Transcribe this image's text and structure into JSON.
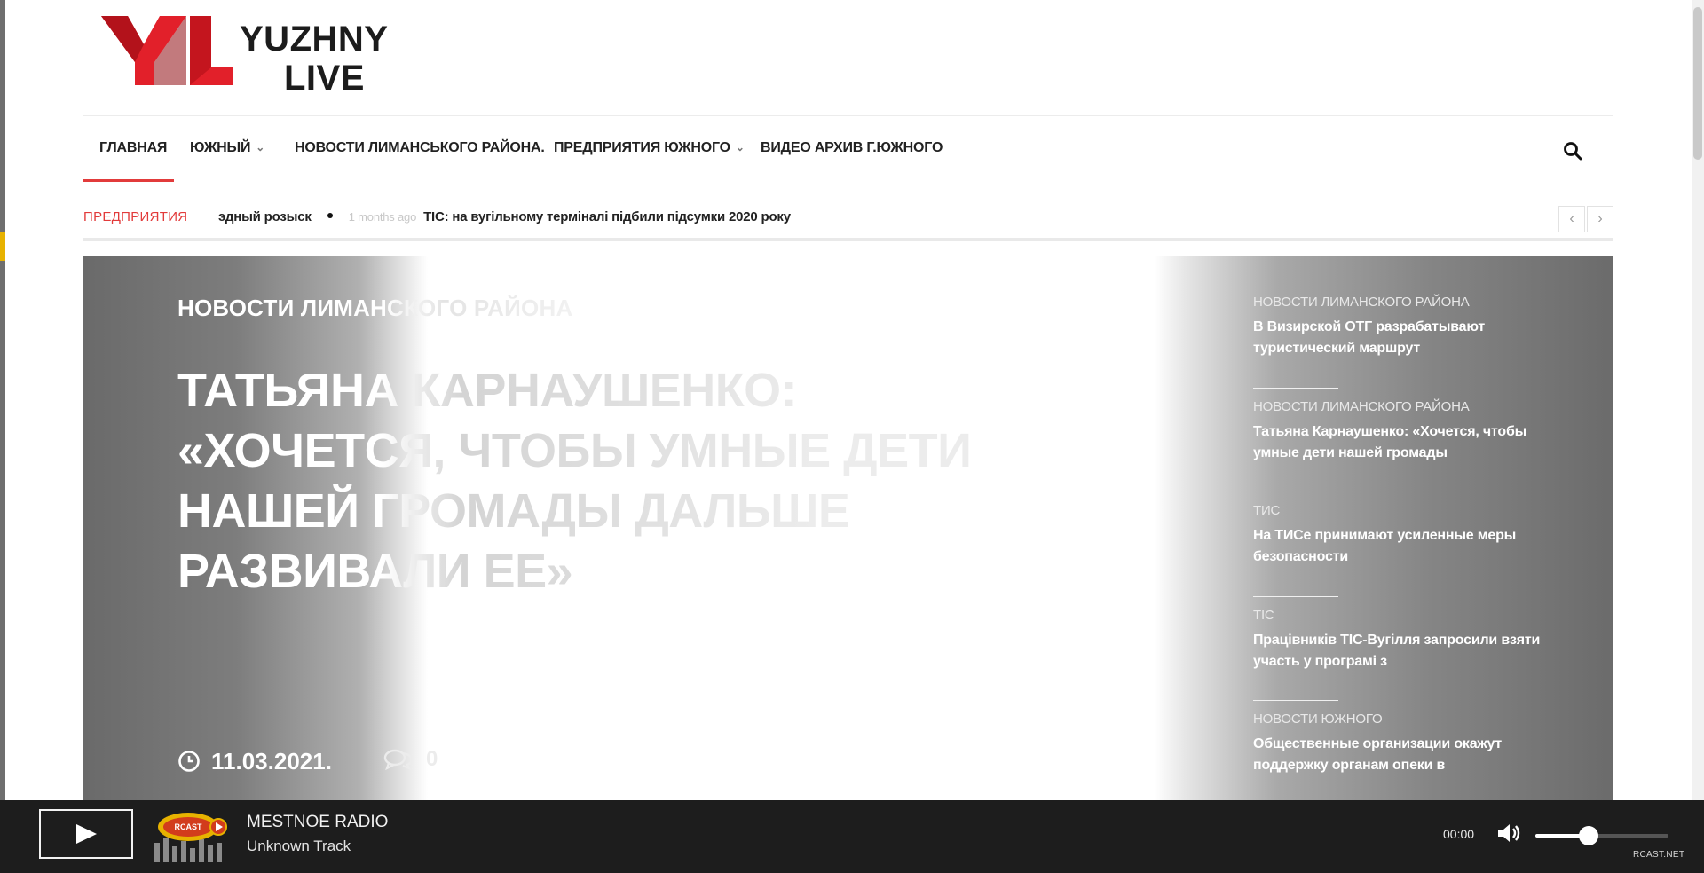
{
  "site": {
    "logo_line1": "YUZHNY",
    "logo_line2": "LIVE",
    "brand_color": "#e2202a"
  },
  "nav": {
    "items": [
      {
        "label": "ГЛАВНАЯ",
        "dropdown": false,
        "active": true
      },
      {
        "label": "ЮЖНЫЙ",
        "dropdown": true,
        "active": false
      },
      {
        "label": "НОВОСТИ ЛИМАНСЬКОГО РАЙОНА.",
        "dropdown": false,
        "active": false
      },
      {
        "label": "ПРЕДПРИЯТИЯ ЮЖНОГО",
        "dropdown": true,
        "active": false
      },
      {
        "label": "ВИДЕО АРХИВ Г.ЮЖНОГО",
        "dropdown": false,
        "active": false
      }
    ],
    "chevron": "⌄",
    "accent_color": "#e23b3b"
  },
  "ticker": {
    "label": "ПРЕДПРИЯТИЯ",
    "prev_text": "эдный розыск",
    "time_ago": "1 months ago",
    "headline": "ТІС: на вугільному терміналі підбили підсумки 2020 року",
    "prev_arrow": "‹",
    "next_arrow": "›"
  },
  "hero": {
    "category": "НОВОСТИ ЛИМАНСКОГО РАЙОНА",
    "title": "ТАТЬЯНА КАРНАУШЕНКО: «ХОЧЕТСЯ, ЧТОБЫ УМНЫЕ ДЕТИ НАШЕЙ ГРОМАДЫ ДАЛЬШЕ РАЗВИВАЛИ ЕЕ»",
    "date": "11.03.2021.",
    "comments": "0",
    "side": [
      {
        "category": "НОВОСТИ ЛИМАНСКОГО РАЙОНА",
        "title": "В Визирской ОТГ разрабатывают туристический маршрут"
      },
      {
        "category": "НОВОСТИ ЛИМАНСКОГО РАЙОНА",
        "title": "Татьяна Карнаушенко: «Хочется, чтобы умные дети нашей громады"
      },
      {
        "category": "ТИС",
        "title": "На ТИСе принимают усиленные меры безопасности"
      },
      {
        "category": "ТІС",
        "title": "Працівників ТІС-Вугілля запросили взяти участь у програмі з"
      },
      {
        "category": "НОВОСТИ ЮЖНОГО",
        "title": "Общественные организации окажут поддержку органам опеки в"
      }
    ]
  },
  "player": {
    "station": "MESTNOE RADIO",
    "track": "Unknown Track",
    "time": "00:00",
    "volume_fraction": 0.4,
    "brand": "RCAST.NET",
    "station_logo_text": "RCAST"
  }
}
